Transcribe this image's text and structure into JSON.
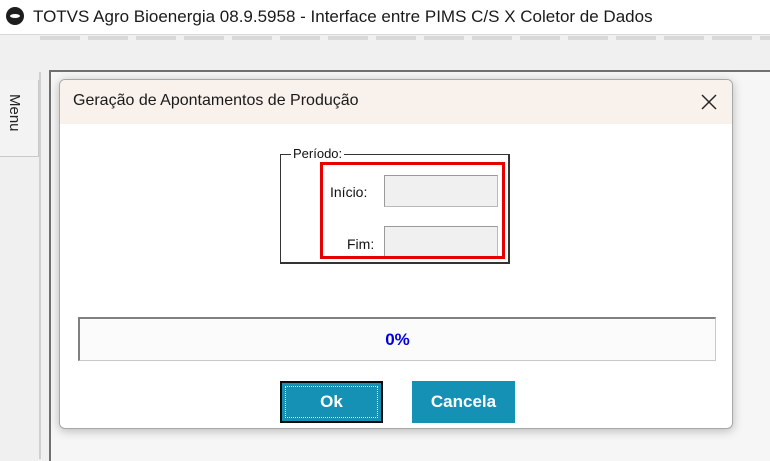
{
  "window": {
    "title": "TOTVS Agro Bioenergia 08.9.5958 - Interface entre PIMS C/S X Coletor de Dados",
    "logo_icon": "totvs-logo-icon"
  },
  "side_menu": {
    "label": "Menu"
  },
  "dialog": {
    "title": "Geração de Apontamentos de Produção",
    "close_icon": "close-icon",
    "period_group": {
      "legend": "Período:",
      "start_label": "Início:",
      "start_value": "",
      "end_label": "Fim:",
      "end_value": ""
    },
    "progress": {
      "value_percent": 0,
      "label": "0%"
    },
    "ok_label": "Ok",
    "cancel_label": "Cancela"
  },
  "colors": {
    "button_bg": "#1591b6",
    "progress_text": "#0000e0",
    "highlight_border": "#e60000",
    "dialog_header_bg": "#f9f1ec"
  }
}
